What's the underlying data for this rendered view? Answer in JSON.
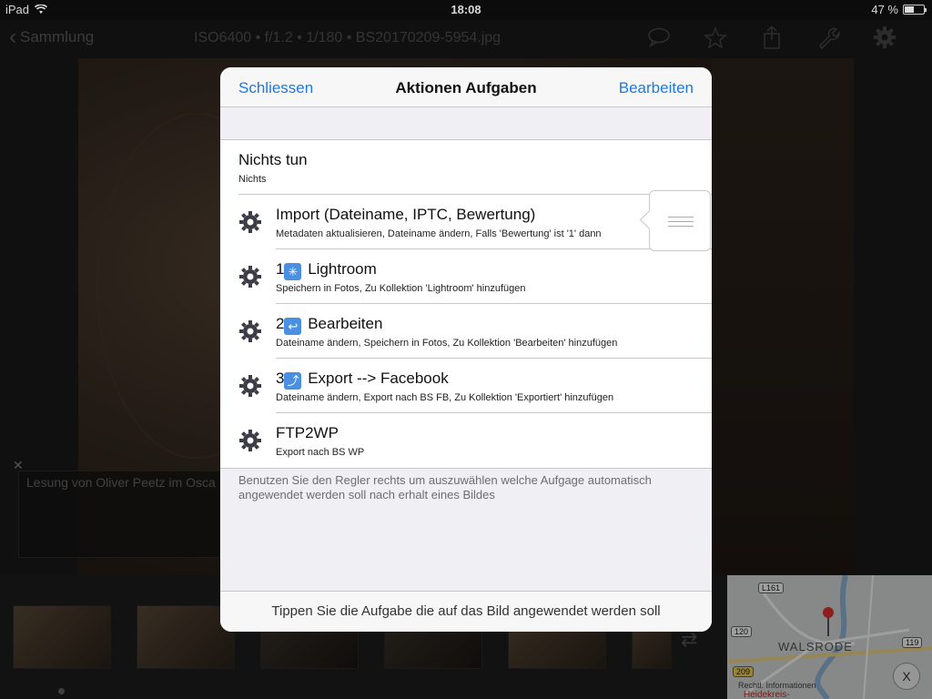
{
  "status": {
    "device": "iPad",
    "time": "18:08",
    "battery": "47 %"
  },
  "nav": {
    "back_label": "Sammlung",
    "photo_info": "ISO6400  •  f/1.2  •  1/180  •  BS20170209-5954.jpg",
    "icons": [
      "comment-icon",
      "star-icon",
      "share-icon",
      "wrench-icon",
      "gear-icon"
    ]
  },
  "caption": {
    "text": "Lesung von Oliver Peetz im Osca"
  },
  "modal": {
    "close_label": "Schliessen",
    "title": "Aktionen Aufgaben",
    "edit_label": "Bearbeiten",
    "items": [
      {
        "title": "Nichts tun",
        "subtitle": "Nichts",
        "icon": ""
      },
      {
        "title": "Import (Dateiname, IPTC, Bewertung)",
        "subtitle": "Metadaten aktualisieren, Dateiname ändern, Falls 'Bewertung' ist '1' dann",
        "icon": "gear-icon"
      },
      {
        "prefix": "1",
        "emoji": "✳",
        "title": "Lightroom",
        "subtitle": "Speichern in Fotos, Zu Kollektion 'Lightroom' hinzufügen",
        "icon": "gear-icon"
      },
      {
        "prefix": "2",
        "emoji": "↩",
        "title": "Bearbeiten",
        "subtitle": "Dateiname ändern, Speichern in Fotos, Zu Kollektion 'Bearbeiten' hinzufügen",
        "icon": "gear-icon"
      },
      {
        "prefix": "3",
        "emoji": "⤴",
        "title": "Export --> Facebook",
        "subtitle": "Dateiname ändern, Export nach BS FB, Zu Kollektion 'Exportiert' hinzufügen",
        "icon": "gear-icon"
      },
      {
        "title": "FTP2WP",
        "subtitle": "Export nach BS WP",
        "icon": "gear-icon"
      }
    ],
    "footer_note": "Benutzen Sie den Regler rechts um auszuwählen welche Aufgage automatisch angewendet werden soll nach erhalt eines Bildes",
    "bottom_hint": "Tippen Sie die Aufgabe die auf das Bild angewendet werden soll"
  },
  "map": {
    "city": "WALSRODE",
    "roads": [
      "L161",
      "120",
      "119",
      "209"
    ],
    "poi": "Rechtl. Informationen",
    "district": "Heidekreis-",
    "close_label": "X"
  },
  "colors": {
    "accent": "#1a7ae6",
    "gear": "#3c3c46"
  }
}
